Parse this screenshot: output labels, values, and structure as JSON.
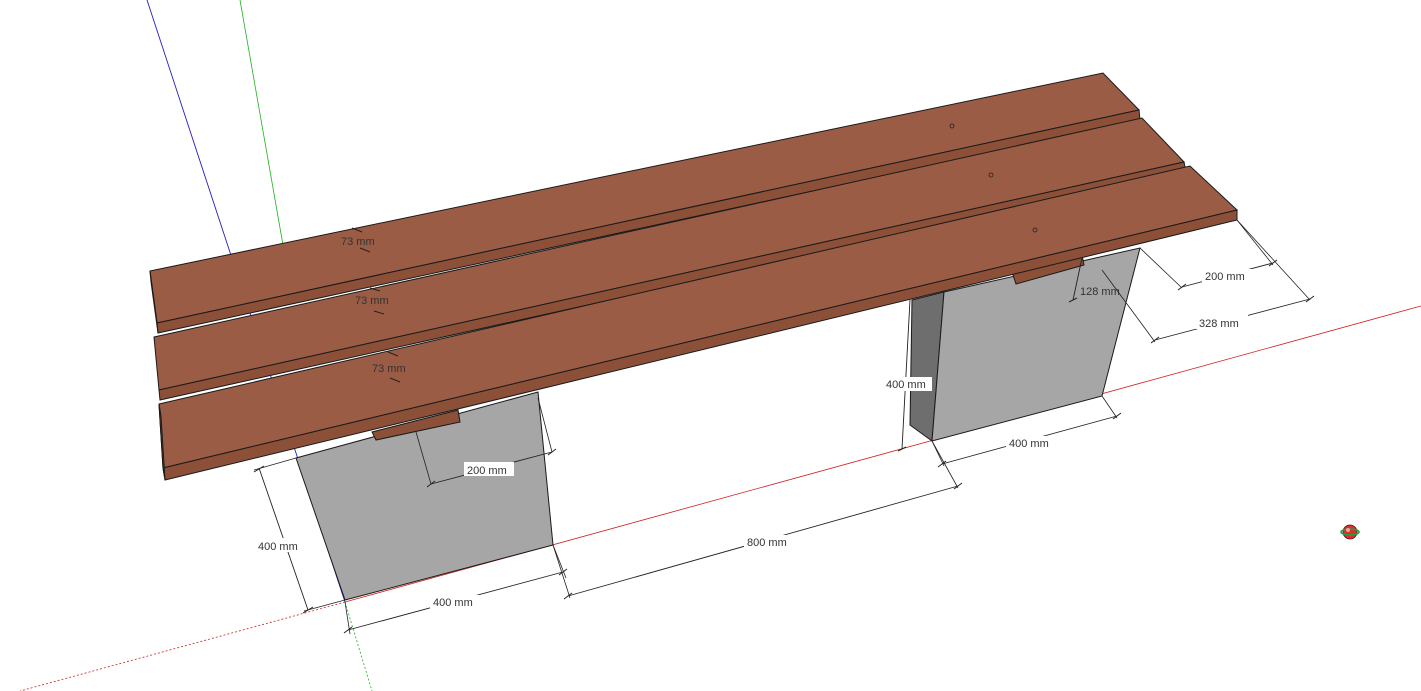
{
  "scene": {
    "colors": {
      "background": "#ffffff",
      "wood_top": "#9b5c45",
      "wood_front": "#8c5039",
      "wood_side": "#7d4632",
      "concrete_front": "#a6a6a6",
      "concrete_side": "#6e6e6e",
      "axis_red": "#d02020",
      "axis_green": "#20b020",
      "axis_blue": "#2020c0"
    },
    "axes": [
      "red-axis",
      "green-axis",
      "blue-axis"
    ]
  },
  "dimensions": {
    "plank_width_1": "73 mm",
    "plank_width_2": "73 mm",
    "plank_width_3": "73 mm",
    "left_block_height": "400 mm",
    "left_block_width": "400 mm",
    "left_beam_width": "200 mm",
    "gap_between_blocks": "800 mm",
    "right_block_height": "400 mm",
    "right_block_width": "400 mm",
    "right_beam_width": "200 mm",
    "right_overhang": "328 mm",
    "right_beam_height": "128 mm"
  },
  "overlay": {
    "orbit_cursor_icon": "orbit-icon"
  }
}
